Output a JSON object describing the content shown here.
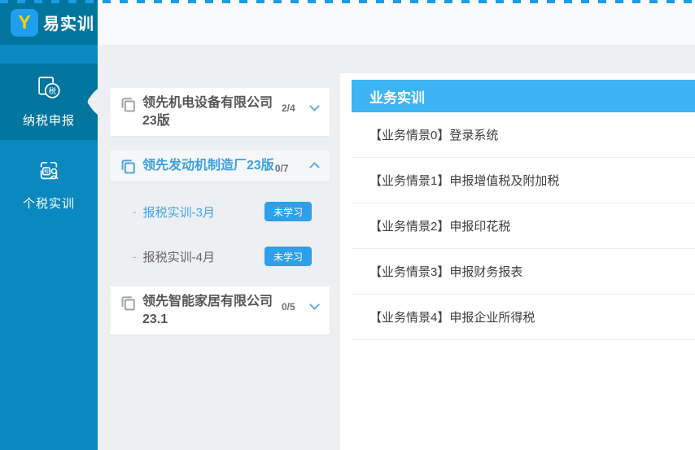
{
  "brand": {
    "logo_letter": "Y",
    "app_name": "易实训"
  },
  "sidebar": {
    "tax_char": "税",
    "items": [
      {
        "label": "纳税申报",
        "icon": "tax-declaration-icon",
        "active": true
      },
      {
        "label": "个税实训",
        "icon": "personal-tax-icon",
        "active": false
      }
    ]
  },
  "courses": [
    {
      "name": "领先机电设备有限公司23版",
      "progress": "2/4",
      "expanded": false,
      "lessons": []
    },
    {
      "name": "领先发动机制造厂23版",
      "progress": "0/7",
      "expanded": true,
      "lessons": [
        {
          "title": "报税实训-3月",
          "status": "未学习",
          "active": true
        },
        {
          "title": "报税实训-4月",
          "status": "未学习",
          "active": false
        }
      ]
    },
    {
      "name": "领先智能家居有限公司23.1",
      "progress": "0/5",
      "expanded": false,
      "lessons": []
    }
  ],
  "panel": {
    "title": "业务实训",
    "scenarios": [
      "【业务情景0】登录系统",
      "【业务情景1】申报增值税及附加税",
      "【业务情景2】申报印花税",
      "【业务情景3】申报财务报表",
      "【业务情景4】申报企业所得税"
    ]
  },
  "ui": {
    "lesson_bullet": "-"
  },
  "colors": {
    "header_teal": "#02759f",
    "sidebar_blue": "#0a88c0",
    "logo_tile_blue": "#1f9fee",
    "logo_letter_yellow": "#ffd200",
    "panel_header_blue": "#3db5f4",
    "status_button_blue": "#2f9fe8",
    "active_link_blue": "#45a4e4",
    "dash_strip_blue": "#1b9ce4"
  }
}
